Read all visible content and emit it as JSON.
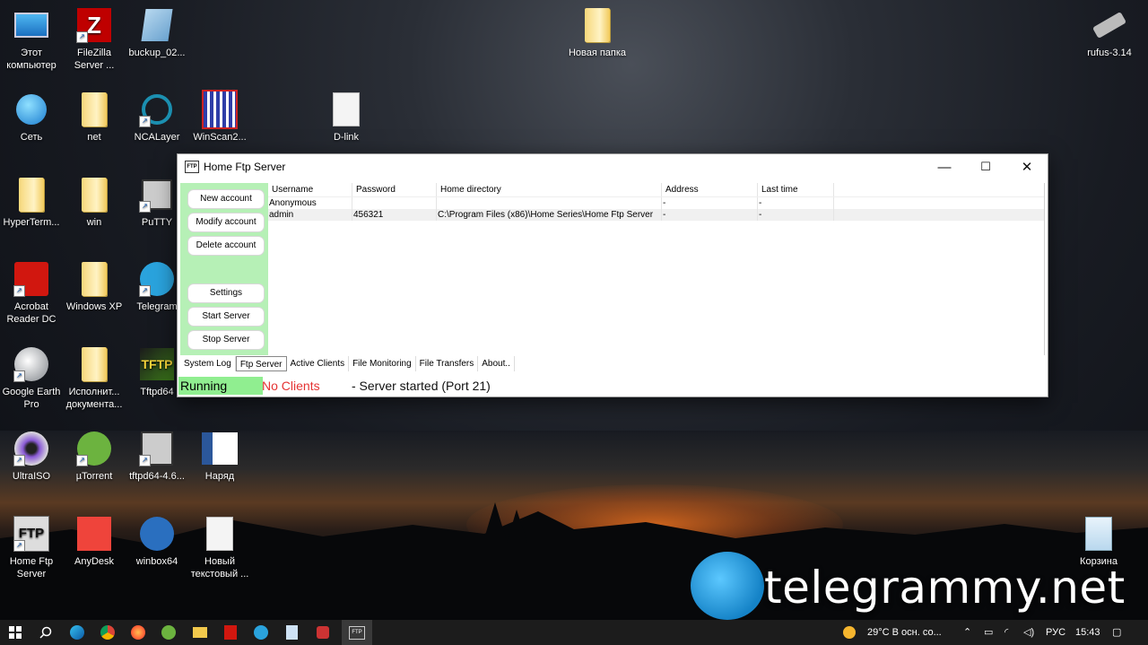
{
  "desktop": {
    "icons": [
      {
        "label": "Этот компьютер",
        "icon": "computer-icon"
      },
      {
        "label": "FileZilla Server ...",
        "icon": "filezilla-icon"
      },
      {
        "label": "buckup_02...",
        "icon": "notebook-icon"
      },
      {
        "label": "Новая папка",
        "icon": "folder-icon"
      },
      {
        "label": "rufus-3.14",
        "icon": "usb-drive-icon"
      },
      {
        "label": "Сеть",
        "icon": "network-globe-icon"
      },
      {
        "label": "net",
        "icon": "folder-icon"
      },
      {
        "label": "NCALayer",
        "icon": "ncalayer-icon"
      },
      {
        "label": "WinScan2...",
        "icon": "winscan-icon"
      },
      {
        "label": "D-link",
        "icon": "document-icon"
      },
      {
        "label": "HyperTerm...",
        "icon": "folder-icon"
      },
      {
        "label": "win",
        "icon": "folder-icon"
      },
      {
        "label": "PuTTY",
        "icon": "putty-icon"
      },
      {
        "label": "Acrobat Reader DC",
        "icon": "acrobat-icon"
      },
      {
        "label": "Windows XP",
        "icon": "folder-icon"
      },
      {
        "label": "Telegram",
        "icon": "telegram-icon"
      },
      {
        "label": "Google Earth Pro",
        "icon": "google-earth-icon"
      },
      {
        "label": "Исполнит... документа...",
        "icon": "folder-icon"
      },
      {
        "label": "Tftpd64",
        "icon": "tftpd-icon"
      },
      {
        "label": "UltraISO",
        "icon": "disc-icon"
      },
      {
        "label": "µTorrent",
        "icon": "utorrent-icon"
      },
      {
        "label": "tftpd64-4.6...",
        "icon": "installer-icon"
      },
      {
        "label": "Наряд",
        "icon": "word-doc-icon"
      },
      {
        "label": "Home Ftp Server",
        "icon": "ftp-icon"
      },
      {
        "label": "AnyDesk",
        "icon": "anydesk-icon"
      },
      {
        "label": "winbox64",
        "icon": "winbox-icon"
      },
      {
        "label": "Новый текстовый ...",
        "icon": "text-doc-icon"
      },
      {
        "label": "Корзина",
        "icon": "recycle-bin-icon"
      }
    ]
  },
  "window": {
    "title": "Home Ftp Server",
    "app_icon_text": "FTP",
    "minimize": "—",
    "maximize": "☐",
    "close": "✕"
  },
  "left_panel": {
    "buttons": [
      "New account",
      "Modify account",
      "Delete account",
      "Settings",
      "Start Server",
      "Stop Server"
    ]
  },
  "accounts_table": {
    "columns": [
      "Username",
      "Password",
      "Home directory",
      "Address",
      "Last time"
    ],
    "rows": [
      [
        "Anonymous",
        "",
        "",
        "-",
        "-"
      ],
      [
        "admin",
        "456321",
        "C:\\Program Files (x86)\\Home Series\\Home Ftp Server",
        "-",
        "-"
      ]
    ]
  },
  "tabs": [
    "System Log",
    "Ftp Server",
    "Active Clients",
    "File Monitoring",
    "File Transfers",
    "About.."
  ],
  "active_tab": "Ftp Server",
  "status": {
    "state": "Running",
    "clients": "No Clients",
    "message": "- Server started (Port 21)"
  },
  "taskbar": {
    "weather": "29°C  В осн. со...",
    "language": "РУС",
    "time": "15:43"
  },
  "watermark": "telegrammy.net",
  "colors": {
    "left_panel": "#b6f0b6",
    "status_running": "#90ee90",
    "status_clients": "#e53333",
    "taskbar": "#1c1c1c"
  }
}
